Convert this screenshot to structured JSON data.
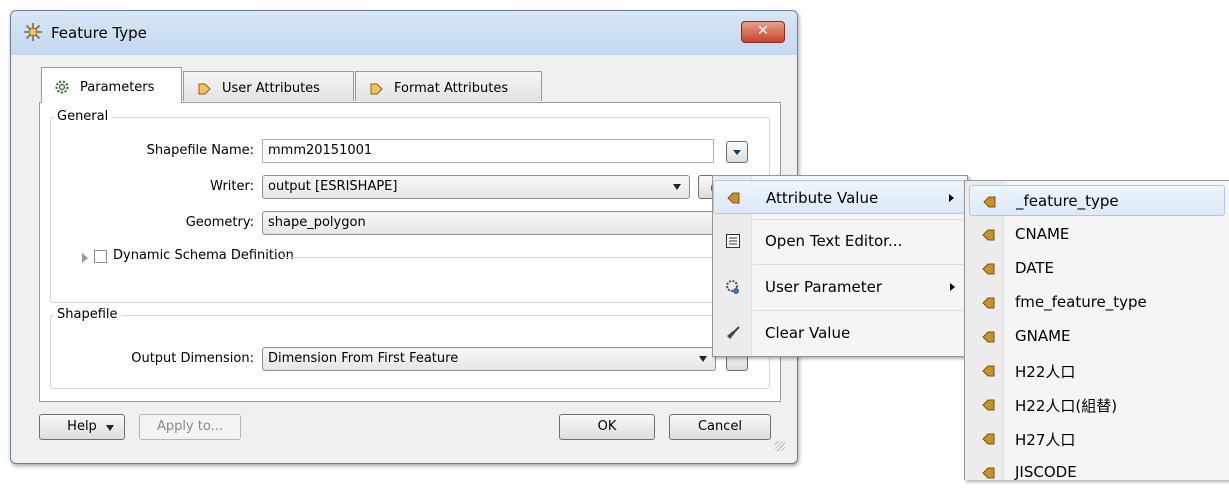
{
  "dialog": {
    "title": "Feature Type",
    "close_symbol": "✕",
    "tabs": [
      {
        "label": "Parameters",
        "icon": "gear-icon"
      },
      {
        "label": "User Attributes",
        "icon": "attribute-arrow-icon"
      },
      {
        "label": "Format Attributes",
        "icon": "attribute-arrow-icon"
      }
    ],
    "general": {
      "legend": "General",
      "shapefile_name_label": "Shapefile Name:",
      "shapefile_name_value": "mmm20151001",
      "writer_label": "Writer:",
      "writer_value": "output [ESRISHAPE]",
      "geometry_label": "Geometry:",
      "geometry_value": "shape_polygon",
      "dynamic_schema_label": "Dynamic Schema Definition"
    },
    "shapefile": {
      "legend": "Shapefile",
      "output_dimension_label": "Output Dimension:",
      "output_dimension_value": "Dimension From First Feature"
    },
    "buttons": {
      "help": "Help",
      "apply_to": "Apply to...",
      "ok": "OK",
      "cancel": "Cancel"
    }
  },
  "context_menu": {
    "items": [
      {
        "label": "Attribute Value",
        "icon": "attribute-arrow-icon",
        "has_submenu": true
      },
      {
        "label": "Open Text Editor...",
        "icon": "text-editor-icon",
        "has_submenu": false
      },
      {
        "label": "User Parameter",
        "icon": "user-parameter-icon",
        "has_submenu": true
      },
      {
        "label": "Clear Value",
        "icon": "broom-icon",
        "has_submenu": false
      }
    ]
  },
  "attribute_submenu": {
    "items": [
      "_feature_type",
      "CNAME",
      "DATE",
      "fme_feature_type",
      "GNAME",
      "H22人口",
      "H22人口(組替)",
      "H27人口",
      "JISCODE"
    ]
  },
  "colors": {
    "attribute_icon": "#c8902a",
    "highlight_border": "#a8c8ec",
    "titlebar": "#c4d8ee"
  }
}
